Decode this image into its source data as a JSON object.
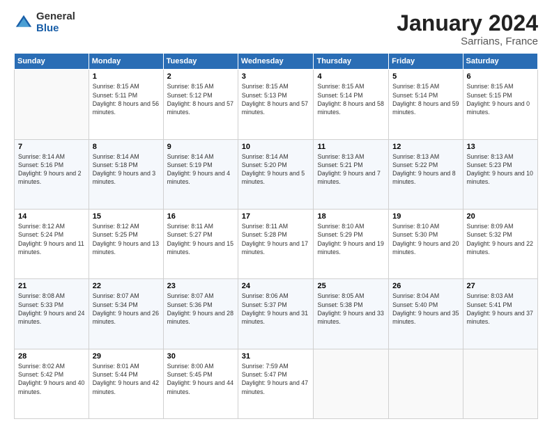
{
  "header": {
    "logo_general": "General",
    "logo_blue": "Blue",
    "title": "January 2024",
    "location": "Sarrians, France"
  },
  "days_of_week": [
    "Sunday",
    "Monday",
    "Tuesday",
    "Wednesday",
    "Thursday",
    "Friday",
    "Saturday"
  ],
  "weeks": [
    [
      {
        "day": "",
        "info": ""
      },
      {
        "day": "1",
        "info": "Sunrise: 8:15 AM\nSunset: 5:11 PM\nDaylight: 8 hours and 56 minutes."
      },
      {
        "day": "2",
        "info": "Sunrise: 8:15 AM\nSunset: 5:12 PM\nDaylight: 8 hours and 57 minutes."
      },
      {
        "day": "3",
        "info": "Sunrise: 8:15 AM\nSunset: 5:13 PM\nDaylight: 8 hours and 57 minutes."
      },
      {
        "day": "4",
        "info": "Sunrise: 8:15 AM\nSunset: 5:14 PM\nDaylight: 8 hours and 58 minutes."
      },
      {
        "day": "5",
        "info": "Sunrise: 8:15 AM\nSunset: 5:14 PM\nDaylight: 8 hours and 59 minutes."
      },
      {
        "day": "6",
        "info": "Sunrise: 8:15 AM\nSunset: 5:15 PM\nDaylight: 9 hours and 0 minutes."
      }
    ],
    [
      {
        "day": "7",
        "info": "Sunrise: 8:14 AM\nSunset: 5:16 PM\nDaylight: 9 hours and 2 minutes."
      },
      {
        "day": "8",
        "info": "Sunrise: 8:14 AM\nSunset: 5:18 PM\nDaylight: 9 hours and 3 minutes."
      },
      {
        "day": "9",
        "info": "Sunrise: 8:14 AM\nSunset: 5:19 PM\nDaylight: 9 hours and 4 minutes."
      },
      {
        "day": "10",
        "info": "Sunrise: 8:14 AM\nSunset: 5:20 PM\nDaylight: 9 hours and 5 minutes."
      },
      {
        "day": "11",
        "info": "Sunrise: 8:13 AM\nSunset: 5:21 PM\nDaylight: 9 hours and 7 minutes."
      },
      {
        "day": "12",
        "info": "Sunrise: 8:13 AM\nSunset: 5:22 PM\nDaylight: 9 hours and 8 minutes."
      },
      {
        "day": "13",
        "info": "Sunrise: 8:13 AM\nSunset: 5:23 PM\nDaylight: 9 hours and 10 minutes."
      }
    ],
    [
      {
        "day": "14",
        "info": "Sunrise: 8:12 AM\nSunset: 5:24 PM\nDaylight: 9 hours and 11 minutes."
      },
      {
        "day": "15",
        "info": "Sunrise: 8:12 AM\nSunset: 5:25 PM\nDaylight: 9 hours and 13 minutes."
      },
      {
        "day": "16",
        "info": "Sunrise: 8:11 AM\nSunset: 5:27 PM\nDaylight: 9 hours and 15 minutes."
      },
      {
        "day": "17",
        "info": "Sunrise: 8:11 AM\nSunset: 5:28 PM\nDaylight: 9 hours and 17 minutes."
      },
      {
        "day": "18",
        "info": "Sunrise: 8:10 AM\nSunset: 5:29 PM\nDaylight: 9 hours and 19 minutes."
      },
      {
        "day": "19",
        "info": "Sunrise: 8:10 AM\nSunset: 5:30 PM\nDaylight: 9 hours and 20 minutes."
      },
      {
        "day": "20",
        "info": "Sunrise: 8:09 AM\nSunset: 5:32 PM\nDaylight: 9 hours and 22 minutes."
      }
    ],
    [
      {
        "day": "21",
        "info": "Sunrise: 8:08 AM\nSunset: 5:33 PM\nDaylight: 9 hours and 24 minutes."
      },
      {
        "day": "22",
        "info": "Sunrise: 8:07 AM\nSunset: 5:34 PM\nDaylight: 9 hours and 26 minutes."
      },
      {
        "day": "23",
        "info": "Sunrise: 8:07 AM\nSunset: 5:36 PM\nDaylight: 9 hours and 28 minutes."
      },
      {
        "day": "24",
        "info": "Sunrise: 8:06 AM\nSunset: 5:37 PM\nDaylight: 9 hours and 31 minutes."
      },
      {
        "day": "25",
        "info": "Sunrise: 8:05 AM\nSunset: 5:38 PM\nDaylight: 9 hours and 33 minutes."
      },
      {
        "day": "26",
        "info": "Sunrise: 8:04 AM\nSunset: 5:40 PM\nDaylight: 9 hours and 35 minutes."
      },
      {
        "day": "27",
        "info": "Sunrise: 8:03 AM\nSunset: 5:41 PM\nDaylight: 9 hours and 37 minutes."
      }
    ],
    [
      {
        "day": "28",
        "info": "Sunrise: 8:02 AM\nSunset: 5:42 PM\nDaylight: 9 hours and 40 minutes."
      },
      {
        "day": "29",
        "info": "Sunrise: 8:01 AM\nSunset: 5:44 PM\nDaylight: 9 hours and 42 minutes."
      },
      {
        "day": "30",
        "info": "Sunrise: 8:00 AM\nSunset: 5:45 PM\nDaylight: 9 hours and 44 minutes."
      },
      {
        "day": "31",
        "info": "Sunrise: 7:59 AM\nSunset: 5:47 PM\nDaylight: 9 hours and 47 minutes."
      },
      {
        "day": "",
        "info": ""
      },
      {
        "day": "",
        "info": ""
      },
      {
        "day": "",
        "info": ""
      }
    ]
  ]
}
